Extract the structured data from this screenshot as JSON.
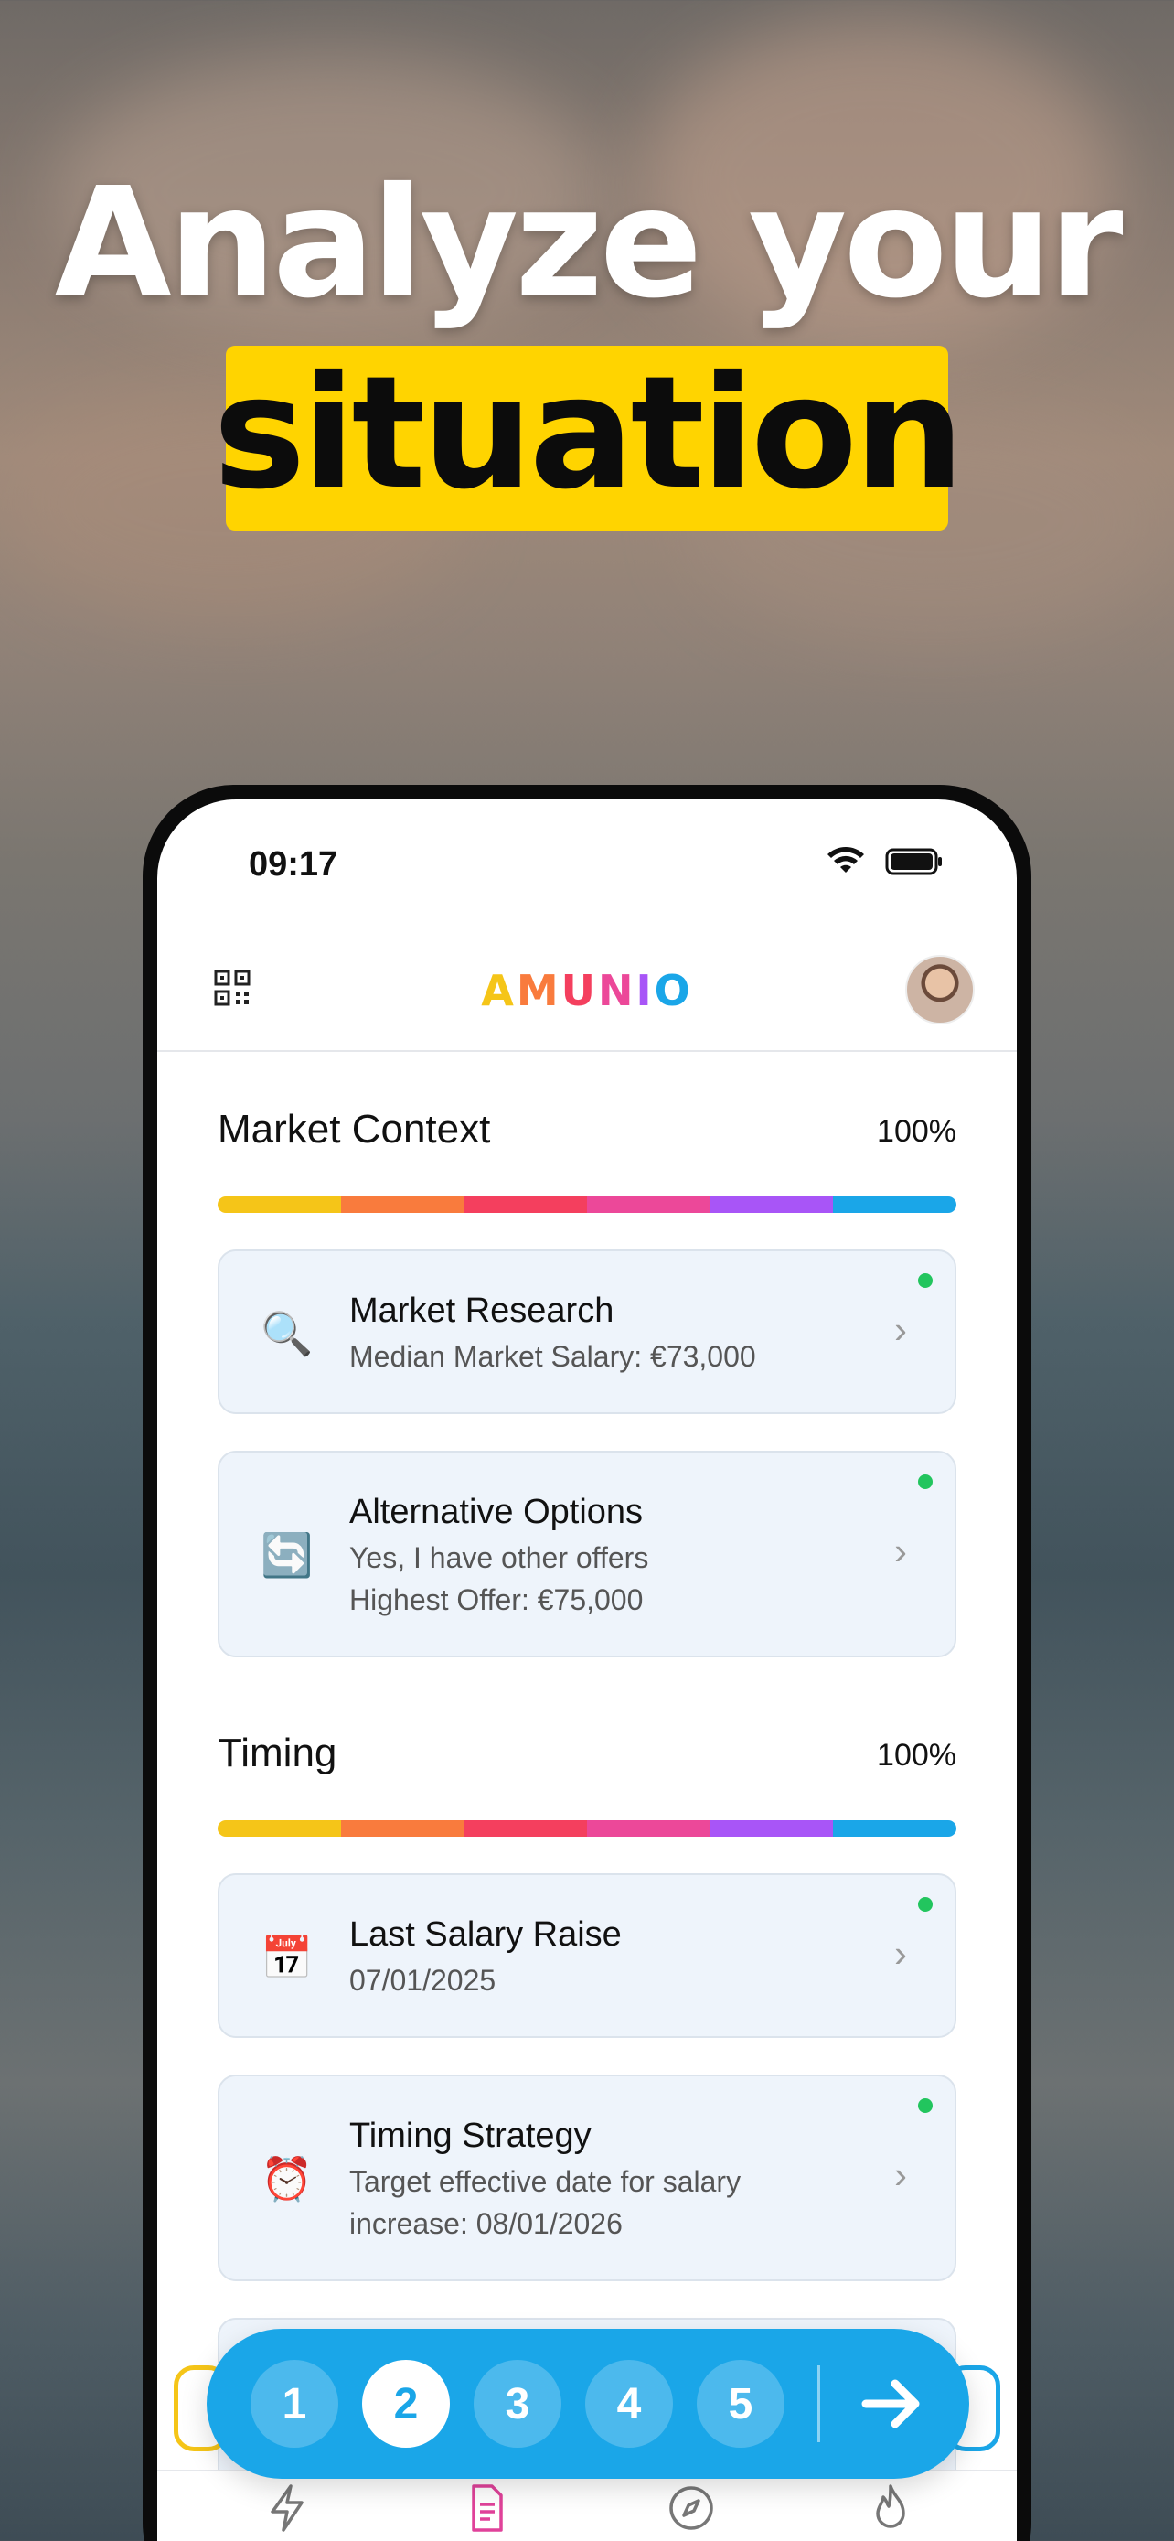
{
  "headline": {
    "line1": "Analyze your",
    "line2": "situation"
  },
  "status_bar": {
    "time": "09:17"
  },
  "app": {
    "logo": "AMUNIO"
  },
  "sections": [
    {
      "title": "Market Context",
      "percent": "100%",
      "cards": [
        {
          "icon": "magnifier-icon",
          "title": "Market Research",
          "lines": [
            "Median Market Salary: €73,000"
          ]
        },
        {
          "icon": "refresh-icon",
          "title": "Alternative Options",
          "lines": [
            "Yes, I have other offers",
            "Highest Offer: €75,000"
          ]
        }
      ]
    },
    {
      "title": "Timing",
      "percent": "100%",
      "cards": [
        {
          "icon": "calendar-icon",
          "title": "Last Salary Raise",
          "lines": [
            "07/01/2025"
          ]
        },
        {
          "icon": "alarm-clock-icon",
          "title": "Timing Strategy",
          "lines": [
            "Target effective date for salary",
            "increase: 08/01/2026"
          ]
        }
      ]
    }
  ],
  "stepper": {
    "steps": [
      "1",
      "2",
      "3",
      "4",
      "5"
    ],
    "active_step": 2
  },
  "colors": {
    "accent_blue": "#1aa6e8",
    "highlight_yellow": "#FFD400",
    "status_green": "#22c55e",
    "progress_segments": [
      "#F5C518",
      "#F97B3D",
      "#F43F5E",
      "#EC4899",
      "#A855F7",
      "#1AA6E8"
    ]
  },
  "tabs": [
    "bolt-icon",
    "document-icon",
    "compass-icon",
    "flame-icon"
  ]
}
